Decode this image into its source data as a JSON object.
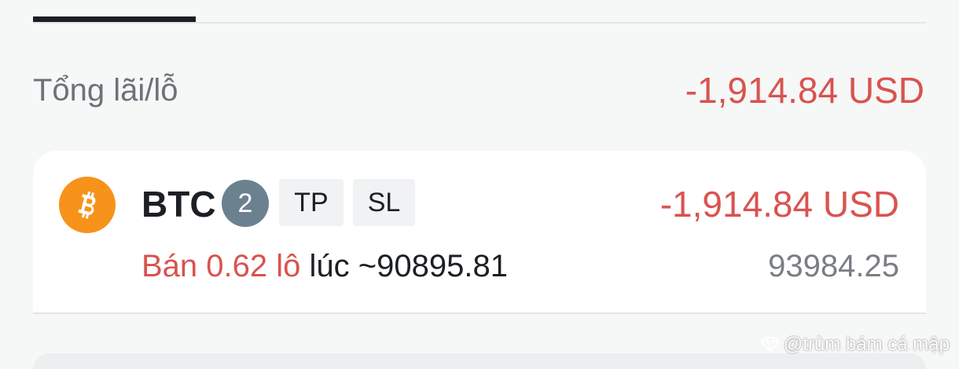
{
  "summary": {
    "label": "Tổng lãi/lỗ",
    "value": "-1,914.84 USD"
  },
  "position": {
    "icon": "bitcoin-icon",
    "symbol": "BTC",
    "count": "2",
    "tp_label": "TP",
    "sl_label": "SL",
    "pl": "-1,914.84 USD",
    "side_text": "Bán 0.62 lô",
    "entry_text": "lúc ~90895.81",
    "current_price": "93984.25"
  },
  "watermark": {
    "text": "@trùm bám cá mập"
  },
  "colors": {
    "loss": "#d9534f",
    "bitcoin": "#f7931a",
    "badge": "#6b8190"
  }
}
